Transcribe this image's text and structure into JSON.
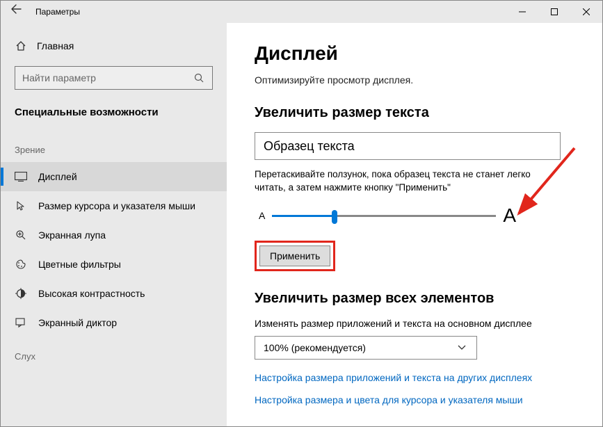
{
  "window": {
    "title": "Параметры",
    "minimize": "—",
    "maximize": "☐",
    "close": "✕"
  },
  "sidebar": {
    "home": "Главная",
    "search_placeholder": "Найти параметр",
    "category": "Специальные возможности",
    "group1": "Зрение",
    "items": [
      {
        "label": "Дисплей"
      },
      {
        "label": "Размер курсора и указателя мыши"
      },
      {
        "label": "Экранная лупа"
      },
      {
        "label": "Цветные фильтры"
      },
      {
        "label": "Высокая контрастность"
      },
      {
        "label": "Экранный диктор"
      }
    ],
    "group2": "Слух"
  },
  "main": {
    "title": "Дисплей",
    "subtitle": "Оптимизируйте просмотр дисплея.",
    "section1_title": "Увеличить размер текста",
    "sample_text": "Образец текста",
    "slider_hint": "Перетаскивайте ползунок, пока образец текста не станет легко читать, а затем нажмите кнопку \"Применить\"",
    "a_small": "A",
    "a_large": "A",
    "apply": "Применить",
    "section2_title": "Увеличить размер всех элементов",
    "section2_desc": "Изменять размер приложений и текста на основном дисплее",
    "scale_value": "100% (рекомендуется)",
    "link1": "Настройка размера приложений и текста на других дисплеях",
    "link2": "Настройка размера и цвета для курсора и указателя мыши"
  }
}
